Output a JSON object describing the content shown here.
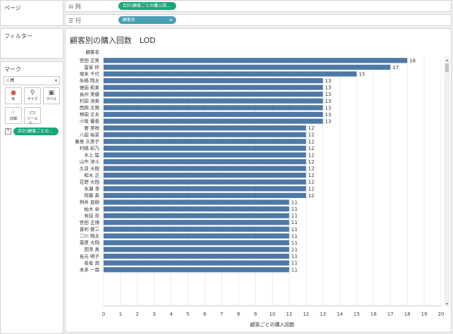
{
  "pages": {
    "title": "ページ"
  },
  "filters": {
    "title": "フィルター"
  },
  "marks": {
    "title": "マーク",
    "type_icon": "bar-icon",
    "type_label": "棒",
    "cards": [
      {
        "label": "色",
        "icon": "color-icon"
      },
      {
        "label": "サイズ",
        "icon": "size-icon"
      },
      {
        "label": "ラベル",
        "icon": "label-icon"
      },
      {
        "label": "詳細",
        "icon": "detail-icon"
      },
      {
        "label": "ツールヒ...",
        "icon": "tooltip-icon"
      }
    ],
    "label_pill": "合計(顧客ごとの..."
  },
  "columns_shelf": {
    "label": "列",
    "pill": "合計(顧客ごとの購入回..."
  },
  "rows_shelf": {
    "label": "行",
    "pill": "顧客名"
  },
  "sheet": {
    "title": "顧客別の購入回数　LOD"
  },
  "colors": {
    "bar": "#4e79a7",
    "pill_measure": "#1aa67a",
    "pill_dimension": "#4aa0b5"
  },
  "chart_data": {
    "type": "bar",
    "orientation": "horizontal",
    "row_header": "顧客名",
    "xlabel": "顧客ごとの購入回数",
    "xlim": [
      0,
      20
    ],
    "xticks": [
      0,
      1,
      2,
      3,
      4,
      5,
      6,
      7,
      8,
      9,
      10,
      11,
      12,
      13,
      14,
      15,
      16,
      17,
      18,
      19,
      20
    ],
    "grid": true,
    "categories": [
      "宮田 正男",
      "富家 修",
      "堀本 千代",
      "矢嶋 翔太",
      "徳田 和美",
      "長州 美優",
      "村田 涼美",
      "西岡 太陽",
      "神田 丈夫",
      "小坂 優香",
      "要 美咲",
      "八田 裕菜",
      "藤島 久美子",
      "村嶋 彩乃",
      "水上 猛",
      "山中 涼斗",
      "久貝 大樹",
      "和木 正",
      "花野 大翔",
      "永瀬 凛",
      "阿藤 真",
      "桝井 直樹",
      "柏木 卓",
      "有田 亮",
      "宮田 正博",
      "喜利 健三",
      "二川 翔太",
      "東原 大翔",
      "田添 真",
      "長元 明子",
      "長坂 潤",
      "本多 一哉"
    ],
    "values": [
      18,
      17,
      15,
      13,
      13,
      13,
      13,
      13,
      13,
      13,
      12,
      12,
      12,
      12,
      12,
      12,
      12,
      12,
      12,
      12,
      12,
      11,
      11,
      11,
      11,
      11,
      11,
      11,
      11,
      11,
      11,
      11
    ]
  }
}
